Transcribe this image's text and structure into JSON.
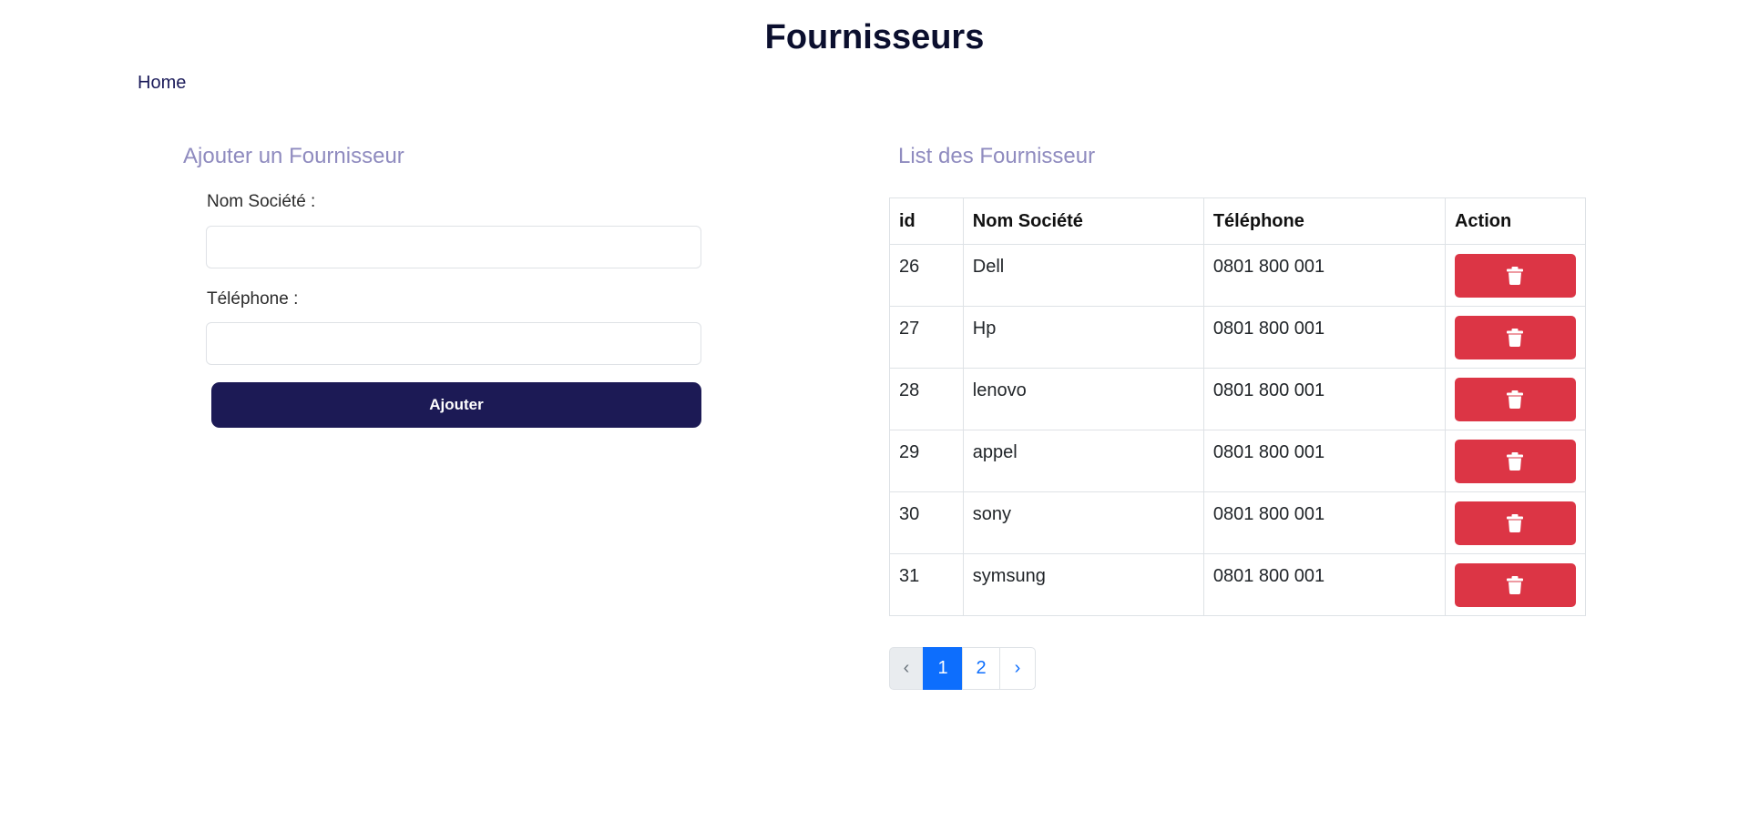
{
  "header": {
    "title": "Fournisseurs",
    "home_link": "Home"
  },
  "form": {
    "title": "Ajouter un Fournisseur",
    "nom_label": "Nom Société :",
    "nom_value": "",
    "tel_label": "Téléphone :",
    "tel_value": "",
    "submit_label": "Ajouter"
  },
  "list": {
    "title": "List des Fournisseur",
    "columns": [
      "id",
      "Nom Société",
      "Téléphone",
      "Action"
    ],
    "rows": [
      {
        "id": "26",
        "nom": "Dell",
        "tel": "0801 800 001",
        "action_icon": "trash-icon"
      },
      {
        "id": "27",
        "nom": "Hp",
        "tel": "0801 800 001",
        "action_icon": "trash-icon"
      },
      {
        "id": "28",
        "nom": "lenovo",
        "tel": "0801 800 001",
        "action_icon": "trash-icon"
      },
      {
        "id": "29",
        "nom": "appel",
        "tel": "0801 800 001",
        "action_icon": "trash-icon"
      },
      {
        "id": "30",
        "nom": "sony",
        "tel": "0801 800 001",
        "action_icon": "trash-icon"
      },
      {
        "id": "31",
        "nom": "symsung",
        "tel": "0801 800 001",
        "action_icon": "trash-icon"
      }
    ]
  },
  "pagination": {
    "prev": "‹",
    "pages": [
      "1",
      "2"
    ],
    "active_page": "1",
    "next": "›"
  },
  "colors": {
    "primary_dark": "#1c1a55",
    "danger": "#dc3545",
    "pagination_active": "#0d6efd",
    "section_title": "#8f8bbf"
  }
}
